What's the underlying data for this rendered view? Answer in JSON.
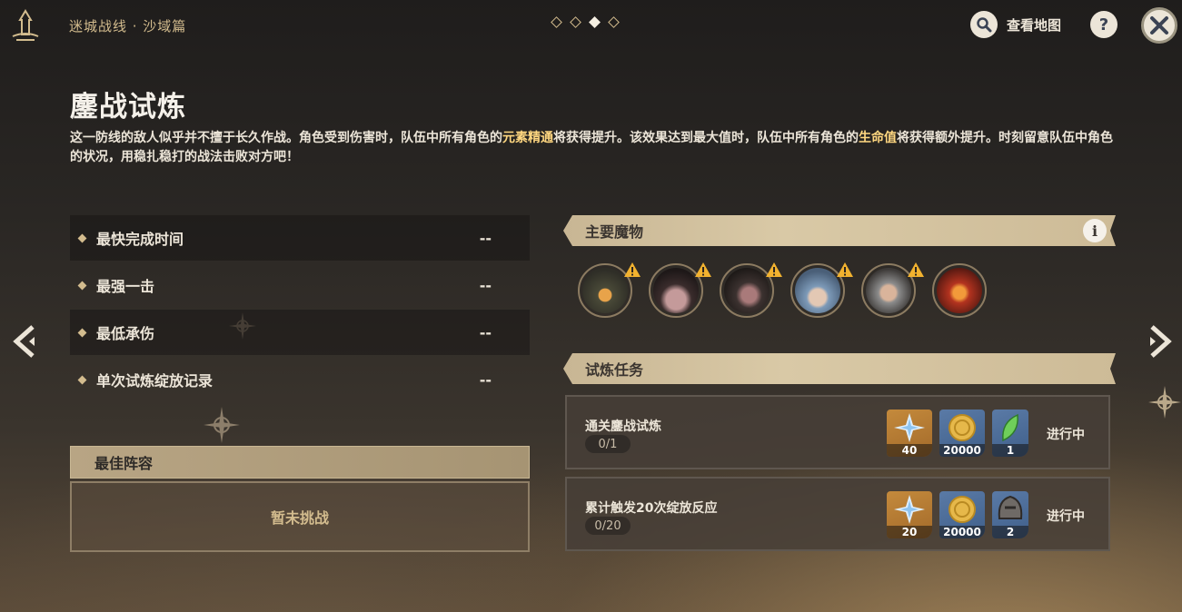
{
  "header": {
    "breadcrumb": "迷城战线 · 沙域篇",
    "page_dots": 4,
    "active_dot": 3,
    "map_label": "查看地图"
  },
  "title": "鏖战试炼",
  "description": {
    "part1": "这一防线的敌人似乎并不擅于长久作战。角色受到伤害时，队伍中所有角色的",
    "hl1": "元素精通",
    "part2": "将获得提升。该效果达到最大值时，队伍中所有角色的",
    "hl2": "生命值",
    "part3": "将获得额外提升。时刻留意队伍中角色的状况，用稳扎稳打的战法击败对方吧！"
  },
  "stats": [
    {
      "label": "最快完成时间",
      "value": "--"
    },
    {
      "label": "最强一击",
      "value": "--"
    },
    {
      "label": "最低承伤",
      "value": "--"
    },
    {
      "label": "单次试炼绽放记录",
      "value": "--"
    }
  ],
  "team": {
    "header": "最佳阵容",
    "empty": "暂未挑战"
  },
  "monsters_section": {
    "header": "主要魔物",
    "count": 6
  },
  "tasks_section": {
    "header": "试炼任务",
    "tasks": [
      {
        "name": "通关鏖战试炼",
        "progress": "0/1",
        "rewards": [
          "40",
          "20000",
          "1"
        ],
        "status": "进行中"
      },
      {
        "name": "累计触发20次绽放反应",
        "progress": "0/20",
        "rewards": [
          "20",
          "20000",
          "2"
        ],
        "status": "进行中"
      }
    ]
  },
  "colors": {
    "accent_gold": "#d3bc8e",
    "highlight": "#ffd780"
  }
}
